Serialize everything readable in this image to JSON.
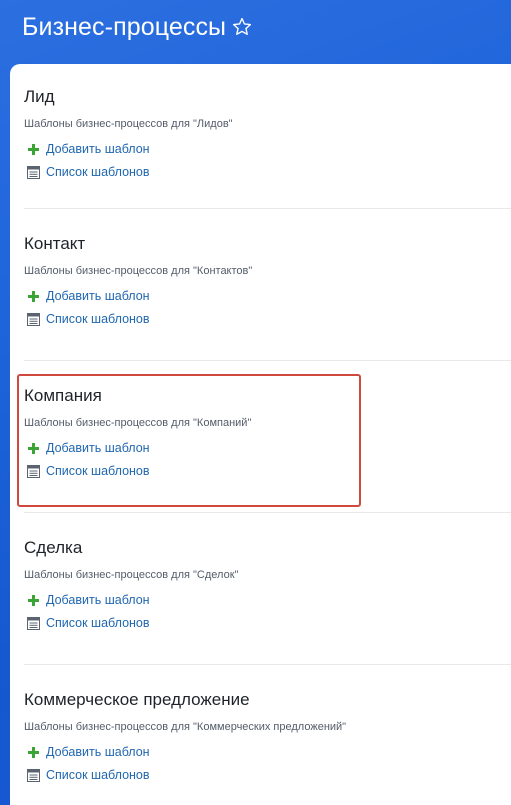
{
  "header": {
    "title": "Бизнес-процессы"
  },
  "sections": [
    {
      "title": "Лид",
      "description": "Шаблоны бизнес-процессов для \"Лидов\"",
      "add_label": "Добавить шаблон",
      "list_label": "Список шаблонов"
    },
    {
      "title": "Контакт",
      "description": "Шаблоны бизнес-процессов для \"Контактов\"",
      "add_label": "Добавить шаблон",
      "list_label": "Список шаблонов"
    },
    {
      "title": "Компания",
      "description": "Шаблоны бизнес-процессов для \"Компаний\"",
      "add_label": "Добавить шаблон",
      "list_label": "Список шаблонов"
    },
    {
      "title": "Сделка",
      "description": "Шаблоны бизнес-процессов для \"Сделок\"",
      "add_label": "Добавить шаблон",
      "list_label": "Список шаблонов"
    },
    {
      "title": "Коммерческое предложение",
      "description": "Шаблоны бизнес-процессов для \"Коммерческих предложений\"",
      "add_label": "Добавить шаблон",
      "list_label": "Список шаблонов"
    }
  ],
  "icons": {
    "add": "plus-icon",
    "list": "list-icon",
    "favorite": "star-icon"
  },
  "colors": {
    "background": "#1e63da",
    "link": "#2067b0",
    "plus": "#3aa435",
    "highlight_border": "#d0493d"
  }
}
